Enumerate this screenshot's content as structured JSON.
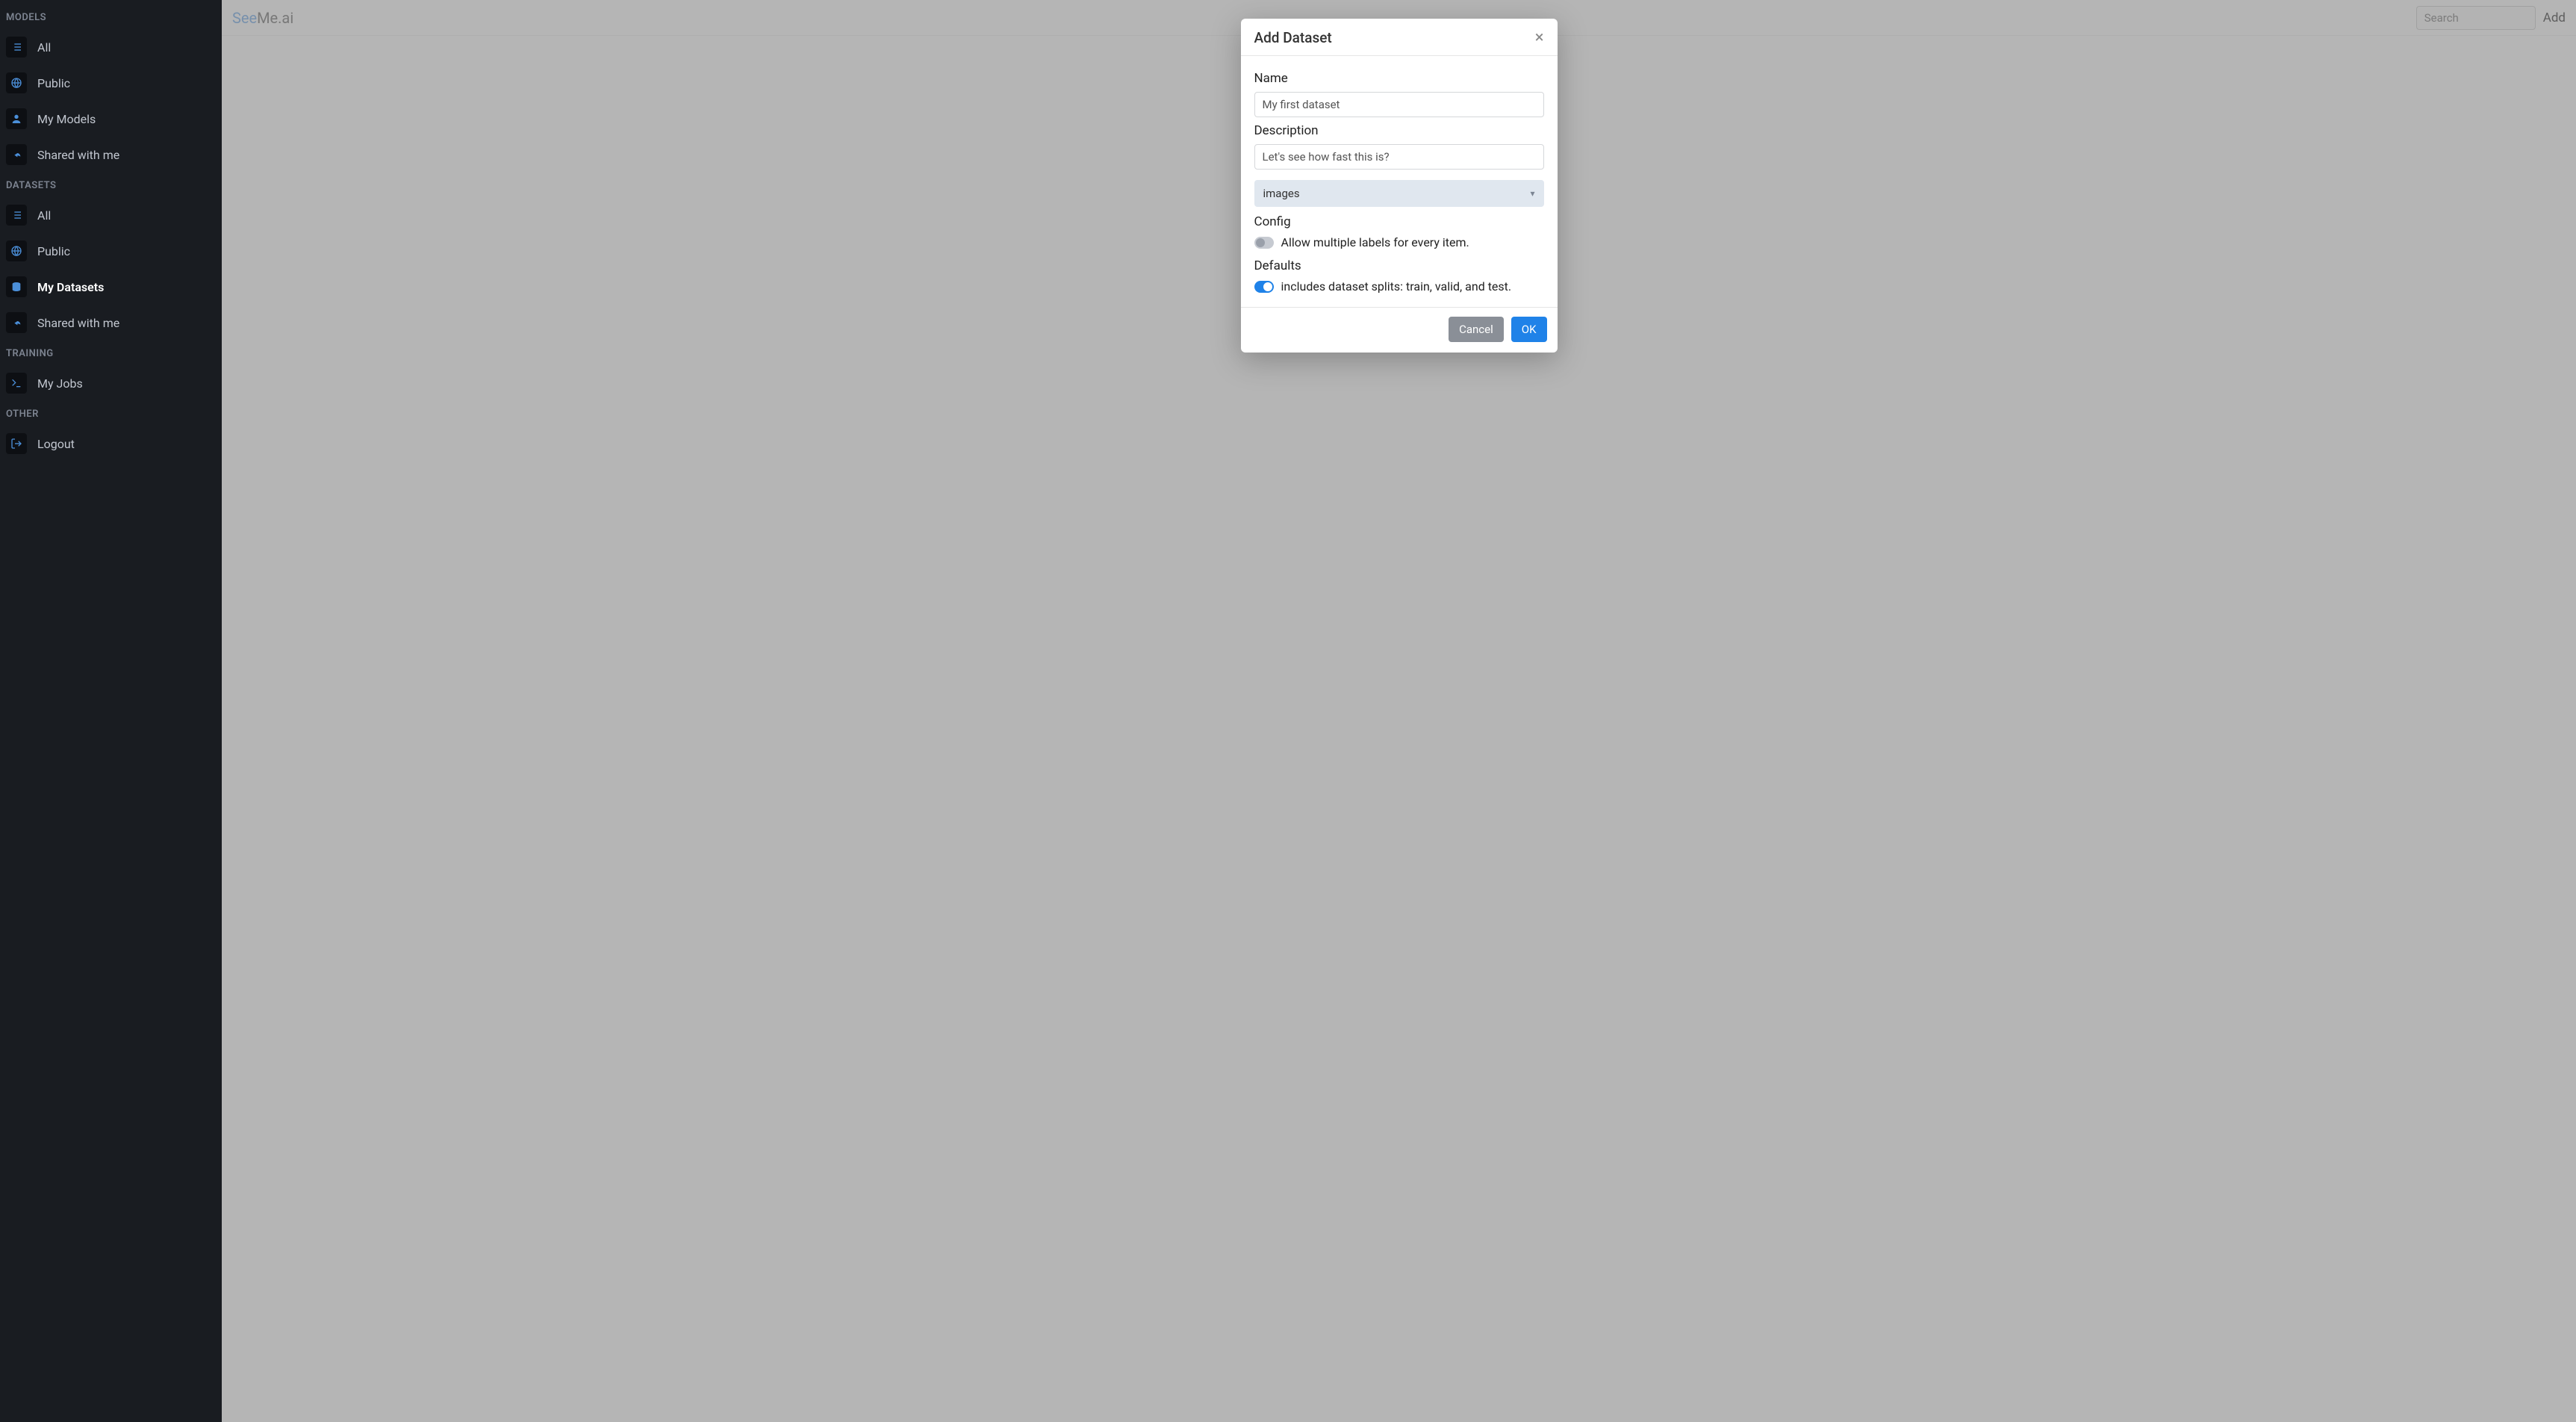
{
  "brand": {
    "part1": "See",
    "part2": "Me.ai"
  },
  "topbar": {
    "search_placeholder": "Search",
    "add_label": "Add"
  },
  "sidebar": {
    "sections": {
      "models": {
        "title": "MODELS",
        "items": [
          "All",
          "Public",
          "My Models",
          "Shared with me"
        ]
      },
      "datasets": {
        "title": "DATASETS",
        "items": [
          "All",
          "Public",
          "My Datasets",
          "Shared with me"
        ],
        "active_index": 2
      },
      "training": {
        "title": "TRAINING",
        "items": [
          "My Jobs"
        ]
      },
      "other": {
        "title": "OTHER",
        "items": [
          "Logout"
        ]
      }
    }
  },
  "modal": {
    "title": "Add Dataset",
    "labels": {
      "name": "Name",
      "description": "Description",
      "config": "Config",
      "defaults": "Defaults"
    },
    "values": {
      "name": "My first dataset",
      "description": "Let's see how fast this is?",
      "type_selected": "images"
    },
    "config": {
      "multi_label_text": "Allow multiple labels for every item.",
      "multi_label_on": false
    },
    "defaults": {
      "splits_text": "includes dataset splits: train, valid, and test.",
      "splits_on": true
    },
    "buttons": {
      "cancel": "Cancel",
      "ok": "OK"
    }
  }
}
